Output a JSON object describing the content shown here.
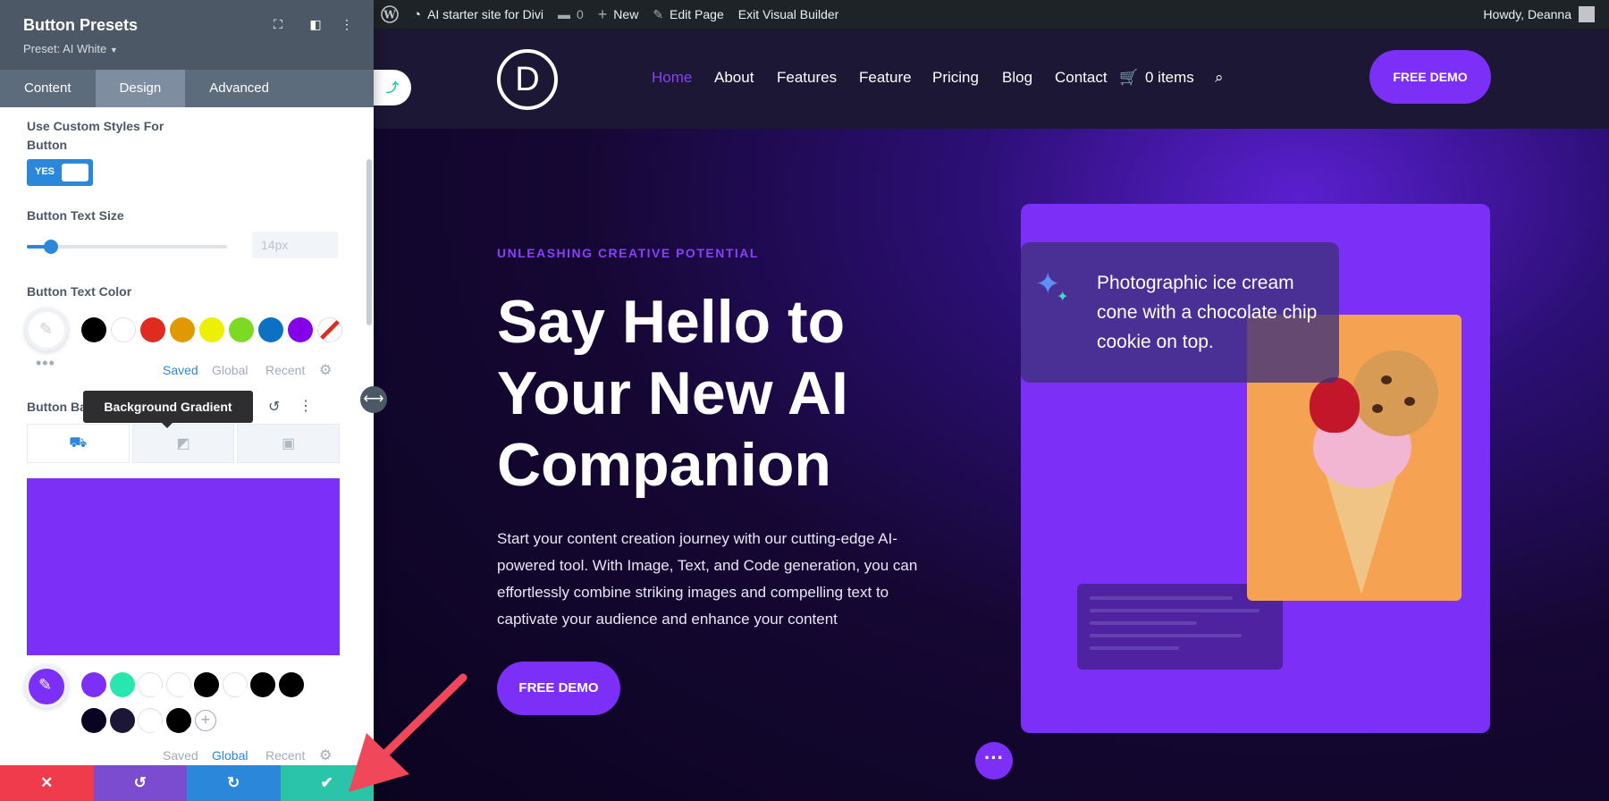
{
  "admin_bar": {
    "site_name": "AI starter site for Divi",
    "comments": "0",
    "new": "New",
    "edit_page": "Edit Page",
    "exit_builder": "Exit Visual Builder",
    "greeting": "Howdy, Deanna"
  },
  "panel": {
    "title": "Button Presets",
    "preset": "Preset: AI White",
    "tabs": [
      "Content",
      "Design",
      "Advanced"
    ],
    "custom_styles_label": "Use Custom Styles For Button",
    "toggle_value": "YES",
    "text_size_label": "Button Text Size",
    "text_size_value": "14px",
    "text_size_fraction": 0.12,
    "text_color_label": "Button Text Color",
    "text_color_swatches": [
      "#000000",
      "#ffffff",
      "#e02b20",
      "#e09900",
      "#edf000",
      "#7cda24",
      "#0c71c3",
      "#8300e9"
    ],
    "color_tabs": [
      "Saved",
      "Global",
      "Recent"
    ],
    "color_tabs_active_1": "Saved",
    "bg_label": "Button Background",
    "tooltip": "Background Gradient",
    "bg_color": "#7c2ff7",
    "gradient_swatches_row1": [
      "#7c2ff7",
      "#29e5b0",
      "#ffffff",
      "#ffffff",
      "#000000",
      "#ffffff",
      "#000000",
      "#000000"
    ],
    "gradient_swatches_row2": [
      "#0b0420",
      "#1c1735",
      "#ffffff",
      "#000000"
    ],
    "color_tabs_active_2": "Global"
  },
  "actions": {
    "cancel_color": "#ef3b4b",
    "undo_color": "#7b4ccf",
    "redo_color": "#2b87da",
    "save_color": "#29c4a9"
  },
  "site": {
    "logo_letter": "D",
    "nav": [
      "Home",
      "About",
      "Features",
      "Feature",
      "Pricing",
      "Blog",
      "Contact"
    ],
    "nav_active": "Home",
    "cart": "0 items",
    "cta_top": "FREE DEMO",
    "eyebrow": "UNLEASHING CREATIVE POTENTIAL",
    "headline": "Say Hello to Your New AI Companion",
    "paragraph": "Start your content creation journey with our cutting-edge AI-powered tool. With Image, Text, and Code generation, you can effortlessly combine striking images and compelling text to captivate your audience and enhance your content",
    "cta_hero": "FREE DEMO",
    "prompt_text": "Photographic ice cream cone with a chocolate chip cookie on top.",
    "accent": "#7c2ff7"
  }
}
